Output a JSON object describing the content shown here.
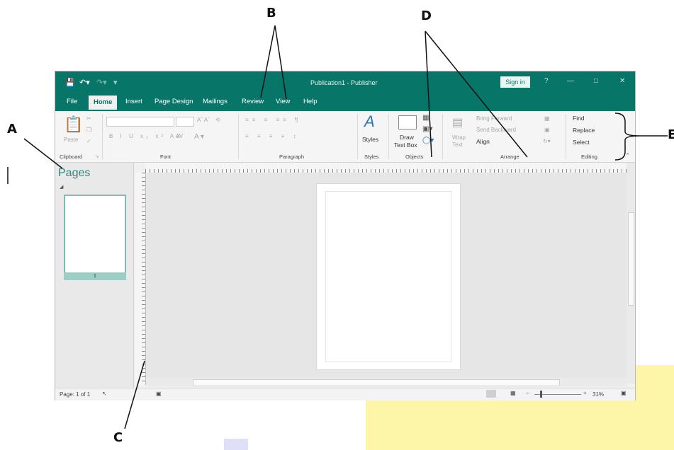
{
  "window": {
    "title": "Publication1 - Publisher",
    "sign_in": "Sign in"
  },
  "tabs": [
    "File",
    "Home",
    "Insert",
    "Page Design",
    "Mailings",
    "Review",
    "View",
    "Help"
  ],
  "ribbon": {
    "clipboard": {
      "label": "Clipboard",
      "paste": "Paste"
    },
    "font": {
      "label": "Font"
    },
    "paragraph": {
      "label": "Paragraph"
    },
    "styles": {
      "label": "Styles",
      "button": "Styles"
    },
    "objects": {
      "label": "Objects",
      "draw_text_box_1": "Draw",
      "draw_text_box_2": "Text Box"
    },
    "arrange": {
      "label": "Arrange",
      "wrap_text_1": "Wrap",
      "wrap_text_2": "Text",
      "bring_forward": "Bring Forward",
      "send_backward": "Send Backward",
      "align": "Align"
    },
    "editing": {
      "label": "Editing",
      "find": "Find",
      "replace": "Replace",
      "select": "Select"
    }
  },
  "pages_pane": {
    "title": "Pages",
    "thumbnail_number": "1"
  },
  "status": {
    "page": "Page: 1 of 1",
    "zoom": "31%"
  },
  "annotations": {
    "a": "A",
    "b": "B",
    "c": "C",
    "d": "D",
    "e": "E"
  }
}
